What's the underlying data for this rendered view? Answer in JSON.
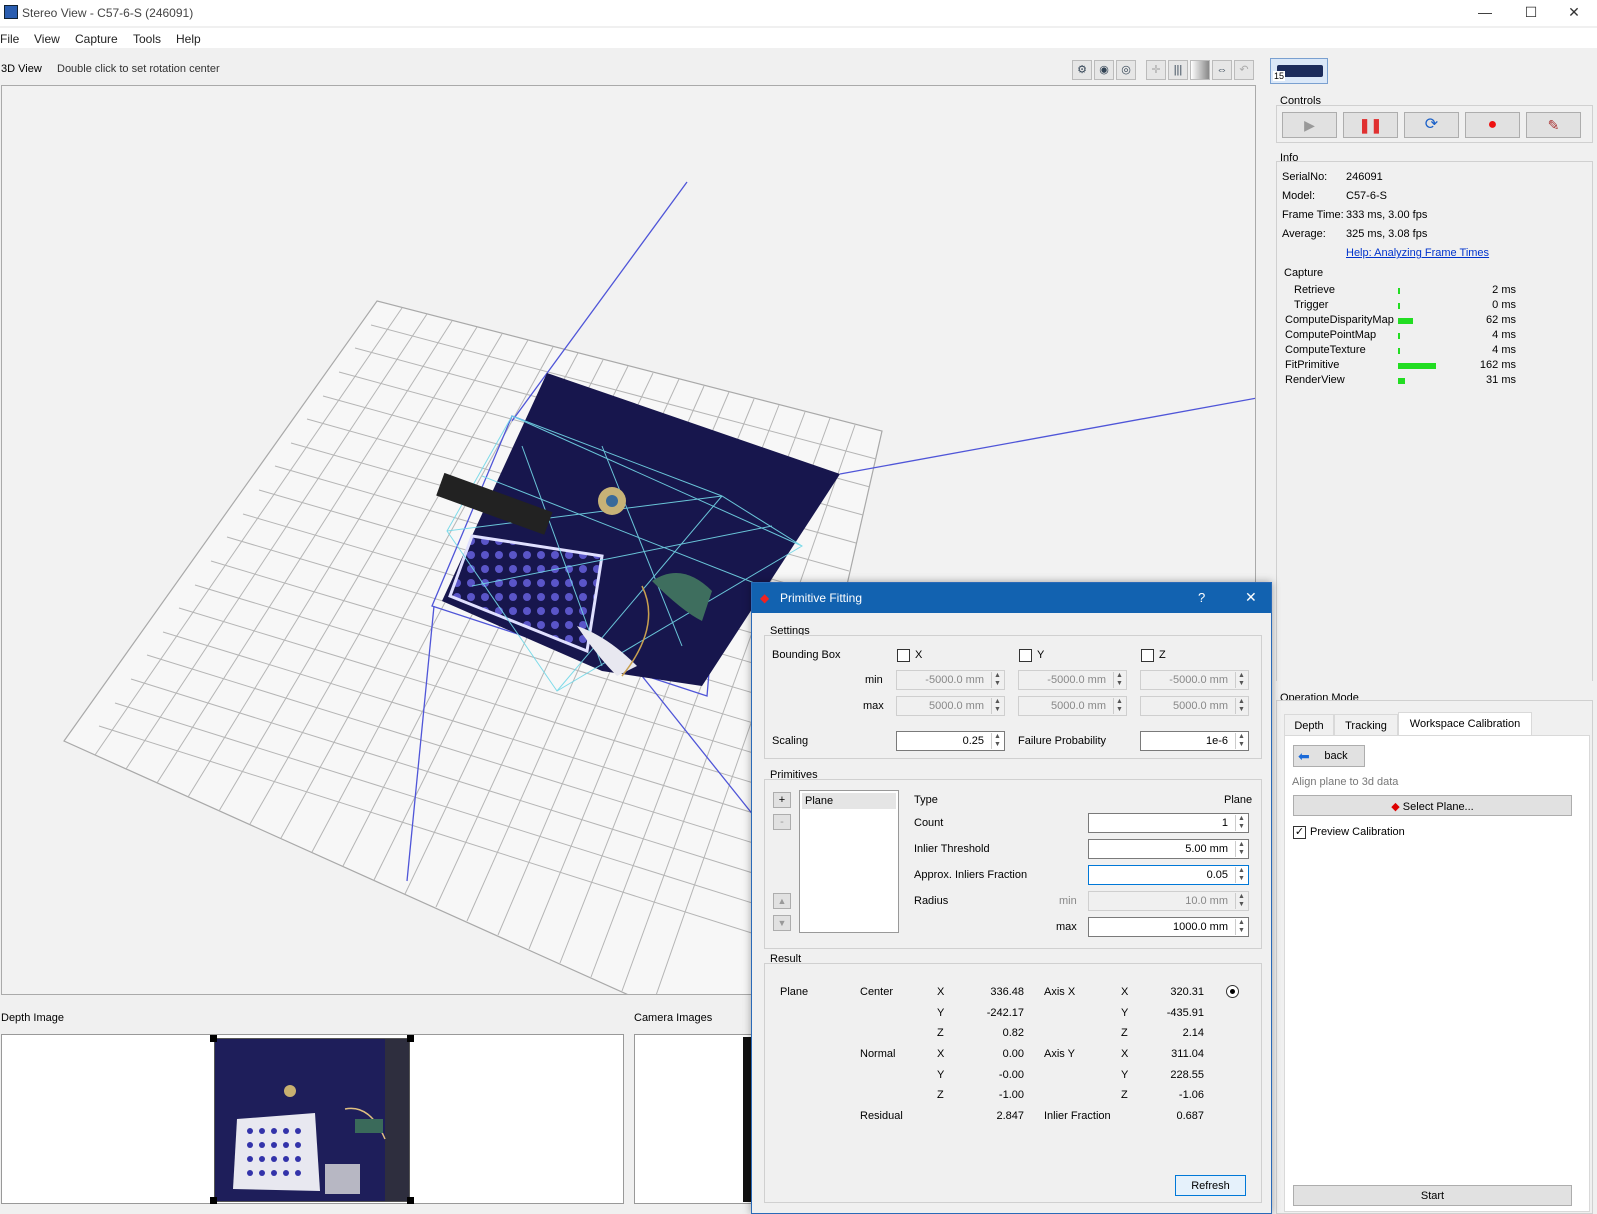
{
  "window": {
    "title": "Stereo View - C57-6-S (246091)",
    "minimize": "—",
    "maximize": "☐",
    "close": "✕"
  },
  "menu": [
    "File",
    "View",
    "Capture",
    "Tools",
    "Help"
  ],
  "view3d": {
    "label": "3D View",
    "hint": "Double click to set rotation center"
  },
  "toolbar_icons": [
    "wrench-eye-icon",
    "eye-icon",
    "eye-outline-icon",
    "crosshair-icon",
    "stripes-icon",
    "gradient-icon",
    "fit-width-icon",
    "undo-icon"
  ],
  "bottom": {
    "depth_label": "Depth Image",
    "camera_label": "Camera Images"
  },
  "right": {
    "camera_badge": "15",
    "controls_label": "Controls",
    "info_label": "Info",
    "info": [
      {
        "k": "SerialNo:",
        "v": "246091"
      },
      {
        "k": "Model:",
        "v": "C57-6-S"
      },
      {
        "k": "Frame Time:",
        "v": "333 ms, 3.00 fps"
      },
      {
        "k": "Average:",
        "v": "325 ms, 3.08 fps"
      }
    ],
    "help_link": "Help: Analyzing Frame Times",
    "capture_label": "Capture",
    "timings": [
      {
        "name": "Retrieve",
        "ms": "2 ms",
        "value": 2
      },
      {
        "name": "Trigger",
        "ms": "0 ms",
        "value": 0
      },
      {
        "name": "ComputeDisparityMap",
        "ms": "62 ms",
        "value": 62
      },
      {
        "name": "ComputePointMap",
        "ms": "4 ms",
        "value": 4
      },
      {
        "name": "ComputeTexture",
        "ms": "4 ms",
        "value": 4
      },
      {
        "name": "FitPrimitive",
        "ms": "162 ms",
        "value": 162
      },
      {
        "name": "RenderView",
        "ms": "31 ms",
        "value": 31
      }
    ],
    "operation_mode_label": "Operation Mode",
    "tabs": [
      "Depth",
      "Tracking",
      "Workspace Calibration"
    ],
    "back": "back",
    "align_hint": "Align plane to 3d data",
    "select_plane": "Select Plane...",
    "preview_calibration": "Preview Calibration",
    "start": "Start"
  },
  "dialog": {
    "title": "Primitive Fitting",
    "help": "?",
    "close": "✕",
    "settings_label": "Settings",
    "bounding_box_label": "Bounding Box",
    "axes": [
      "X",
      "Y",
      "Z"
    ],
    "min_label": "min",
    "max_label": "max",
    "min_values": [
      "-5000.0 mm",
      "-5000.0 mm",
      "-5000.0 mm"
    ],
    "max_values": [
      "5000.0 mm",
      "5000.0 mm",
      "5000.0 mm"
    ],
    "scaling_label": "Scaling",
    "scaling": "0.25",
    "failure_label": "Failure Probability",
    "failure": "1e-6",
    "primitives_label": "Primitives",
    "add": "+",
    "remove": "-",
    "up": "▲",
    "down": "▼",
    "list": [
      "Plane"
    ],
    "type_label": "Type",
    "type": "Plane",
    "count_label": "Count",
    "count": "1",
    "inlier_threshold_label": "Inlier Threshold",
    "inlier_threshold": "5.00 mm",
    "approx_label": "Approx. Inliers Fraction",
    "approx": "0.05",
    "radius_label": "Radius",
    "radius_min_label": "min",
    "radius_min": "10.0 mm",
    "radius_max_label": "max",
    "radius_max": "1000.0 mm",
    "result_label": "Result",
    "result": {
      "plane": "Plane",
      "center": "Center",
      "normal": "Normal",
      "residual_label": "Residual",
      "axis_x": "Axis X",
      "axis_y": "Axis Y",
      "inlier_fraction_label": "Inlier Fraction",
      "X": "X",
      "Y": "Y",
      "Z": "Z",
      "center_vals": [
        "336.48",
        "-242.17",
        "0.82"
      ],
      "normal_vals": [
        "0.00",
        "-0.00",
        "-1.00"
      ],
      "axisx_vals": [
        "320.31",
        "-435.91",
        "2.14"
      ],
      "axisy_vals": [
        "311.04",
        "228.55",
        "-1.06"
      ],
      "residual": "2.847",
      "inlier_fraction": "0.687"
    },
    "refresh": "Refresh"
  }
}
